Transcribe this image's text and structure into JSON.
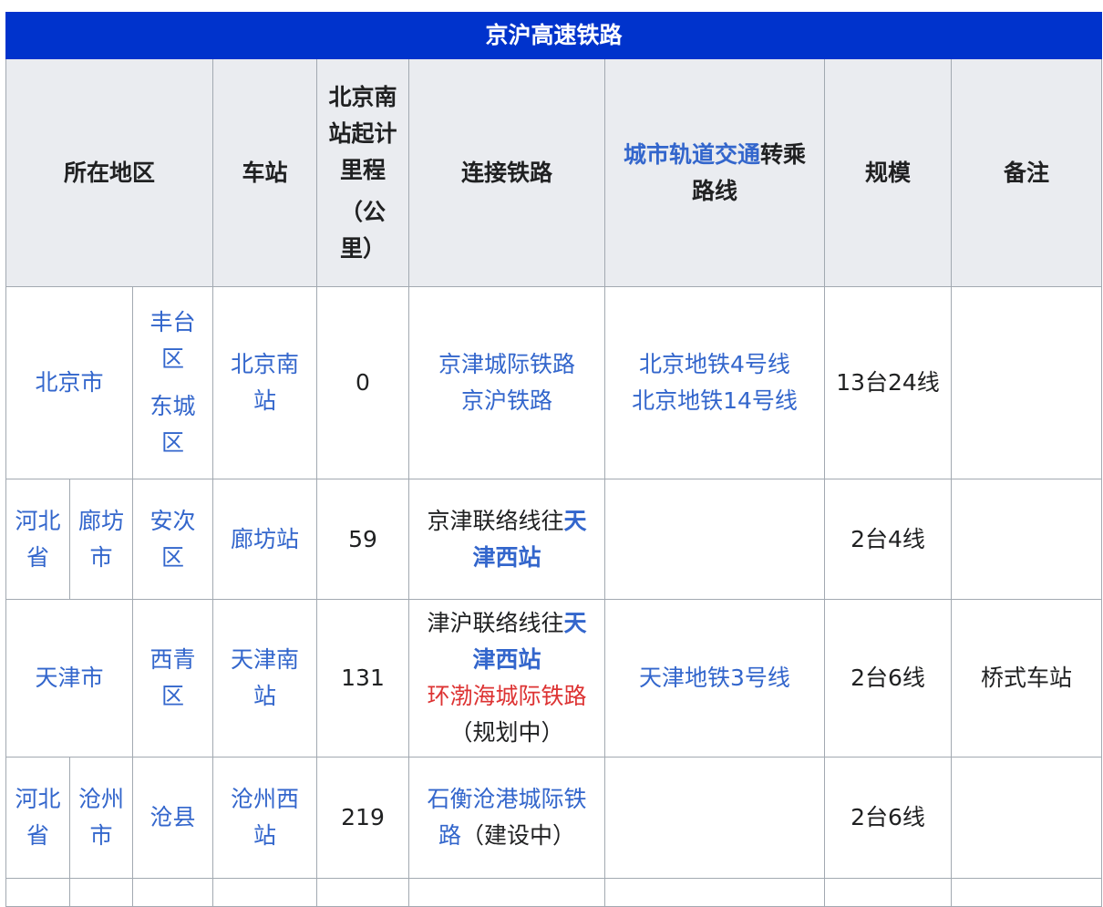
{
  "caption": "京沪高速铁路",
  "headers": {
    "region": "所在地区",
    "station": "车站",
    "mileage_line1": "北京南站起计里程",
    "mileage_line2": "（公里）",
    "railways": "连接铁路",
    "transfer_link": "城市轨道交通",
    "transfer_rest": "转乘路线",
    "scale": "规模",
    "notes": "备注"
  },
  "rows": [
    {
      "province": "北京市",
      "district_a": "丰台区",
      "district_b": "东城区",
      "station": "北京南站",
      "mileage": "0",
      "railways": [
        "京津城际铁路",
        "京沪铁路"
      ],
      "transfer": [
        "北京地铁4号线",
        "北京地铁14号线"
      ],
      "scale": "13台24线",
      "notes": ""
    },
    {
      "province": "河北省",
      "city": "廊坊市",
      "district": "安次区",
      "station": "廊坊站",
      "mileage": "59",
      "rail_prefix": "京津联络线往",
      "rail_bold": "天津西站",
      "transfer": "",
      "scale": "2台4线",
      "notes": ""
    },
    {
      "province": "天津市",
      "district": "西青区",
      "station": "天津南站",
      "mileage": "131",
      "rail_prefix": "津沪联络线往",
      "rail_bold": "天津西站",
      "rail_red": "环渤海城际铁路",
      "rail_note": "（规划中）",
      "transfer": "天津地铁3号线",
      "scale": "2台6线",
      "notes": "桥式车站"
    },
    {
      "province": "河北省",
      "city": "沧州市",
      "district": "沧县",
      "station": "沧州西站",
      "mileage": "219",
      "rail_link": "石衡沧港城际铁路",
      "rail_note": "（建设中）",
      "transfer": "",
      "scale": "2台6线",
      "notes": ""
    }
  ],
  "colors": {
    "caption_bg": "#0033cc",
    "header_bg": "#eaecf0",
    "link": "#3366cc",
    "redlink": "#dd3333",
    "border": "#a2a9b1"
  }
}
